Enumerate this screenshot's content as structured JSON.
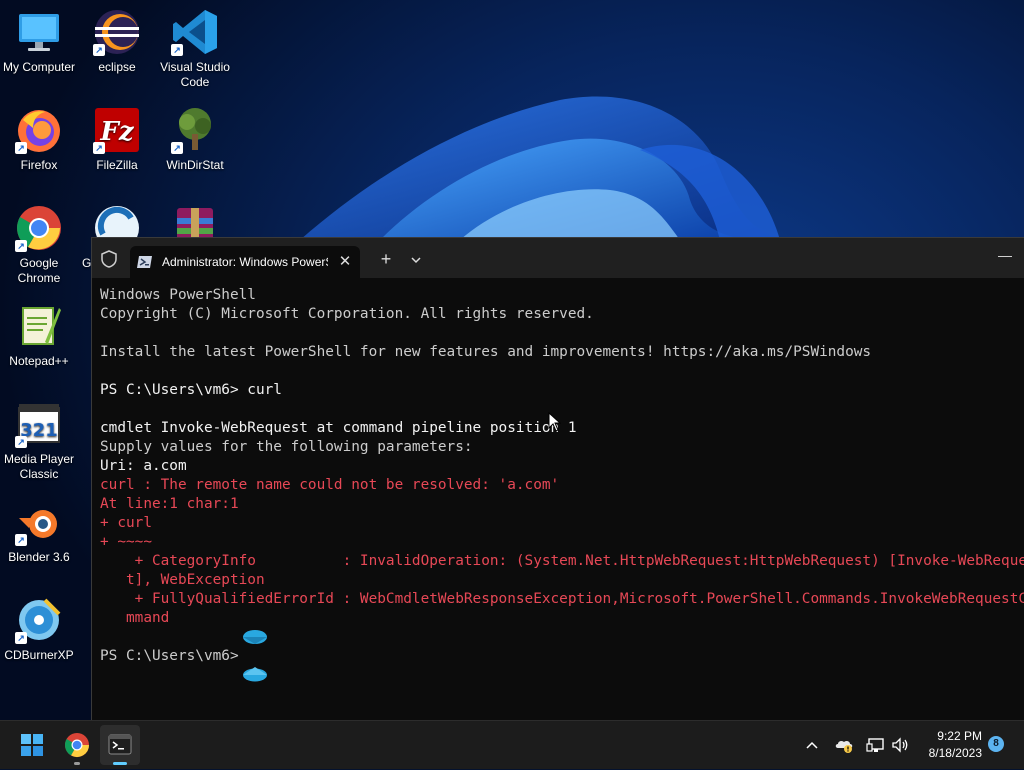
{
  "desktop": {
    "icons": [
      {
        "label": "My Computer",
        "icon": "monitor-icon"
      },
      {
        "label": "eclipse",
        "icon": "eclipse-icon"
      },
      {
        "label": "Visual Studio Code",
        "icon": "vscode-icon"
      },
      {
        "label": "Firefox",
        "icon": "firefox-icon"
      },
      {
        "label": "FileZilla",
        "icon": "filezilla-icon"
      },
      {
        "label": "WinDirStat",
        "icon": "windirstat-icon"
      },
      {
        "label": "Google Chrome",
        "icon": "chrome-icon"
      },
      {
        "label": "Gl",
        "icon": "glary-icon"
      },
      {
        "label": "",
        "icon": "winrar-icon"
      },
      {
        "label": "Notepad++",
        "icon": "notepadpp-icon"
      },
      {
        "label": "Media Player Classic",
        "icon": "mpc-icon"
      },
      {
        "label": "Blender 3.6",
        "icon": "blender-icon"
      },
      {
        "label": "CDBurnerXP",
        "icon": "cdburnerxp-icon"
      }
    ]
  },
  "terminal": {
    "tab_title": "Administrator: Windows PowerShell",
    "new_tab": "+",
    "dropdown": "⌄",
    "close": "✕",
    "minimize": "—",
    "lines": [
      {
        "text": "Windows PowerShell",
        "cls": ""
      },
      {
        "text": "Copyright (C) Microsoft Corporation. All rights reserved.",
        "cls": ""
      },
      {
        "text": "",
        "cls": ""
      },
      {
        "text": "Install the latest PowerShell for new features and improvements! https://aka.ms/PSWindows",
        "cls": ""
      },
      {
        "text": "",
        "cls": ""
      },
      {
        "text": "PS C:\\Users\\vm6> curl",
        "cls": "white"
      },
      {
        "text": "",
        "cls": ""
      },
      {
        "text": "cmdlet Invoke-WebRequest at command pipeline position 1",
        "cls": "white"
      },
      {
        "text": "Supply values for the following parameters:",
        "cls": ""
      },
      {
        "text": "Uri: a.com",
        "cls": "white"
      },
      {
        "text": "curl : The remote name could not be resolved: 'a.com'",
        "cls": "err"
      },
      {
        "text": "At line:1 char:1",
        "cls": "err"
      },
      {
        "text": "+ curl",
        "cls": "err"
      },
      {
        "text": "+ ~~~~",
        "cls": "err"
      },
      {
        "text": "    + CategoryInfo          : InvalidOperation: (System.Net.HttpWebRequest:HttpWebRequest) [Invoke-WebRequest], WebException",
        "cls": "err"
      },
      {
        "text": "   t], WebException",
        "cls": "err"
      },
      {
        "text": "    + FullyQualifiedErrorId : WebCmdletWebResponseException,Microsoft.PowerShell.Commands.InvokeWebRequestCommand",
        "cls": "err"
      },
      {
        "text": "   mmand",
        "cls": "err"
      },
      {
        "text": "",
        "cls": ""
      },
      {
        "text": "PS C:\\Users\\vm6>",
        "cls": ""
      }
    ]
  },
  "taskbar": {
    "items": [
      {
        "name": "start",
        "icon": "windows-logo-icon"
      },
      {
        "name": "chrome",
        "icon": "chrome-icon"
      },
      {
        "name": "terminal",
        "icon": "terminal-icon"
      }
    ],
    "tray": {
      "chevron": "^",
      "icons": [
        "onedrive-warning-icon",
        "network-icon",
        "volume-icon"
      ]
    },
    "time": "9:22 PM",
    "date": "8/18/2023",
    "notifications": "8"
  },
  "colors": {
    "terminal_bg": "#0c0c0c",
    "error_red": "#e74856",
    "accent": "#60cdff"
  }
}
